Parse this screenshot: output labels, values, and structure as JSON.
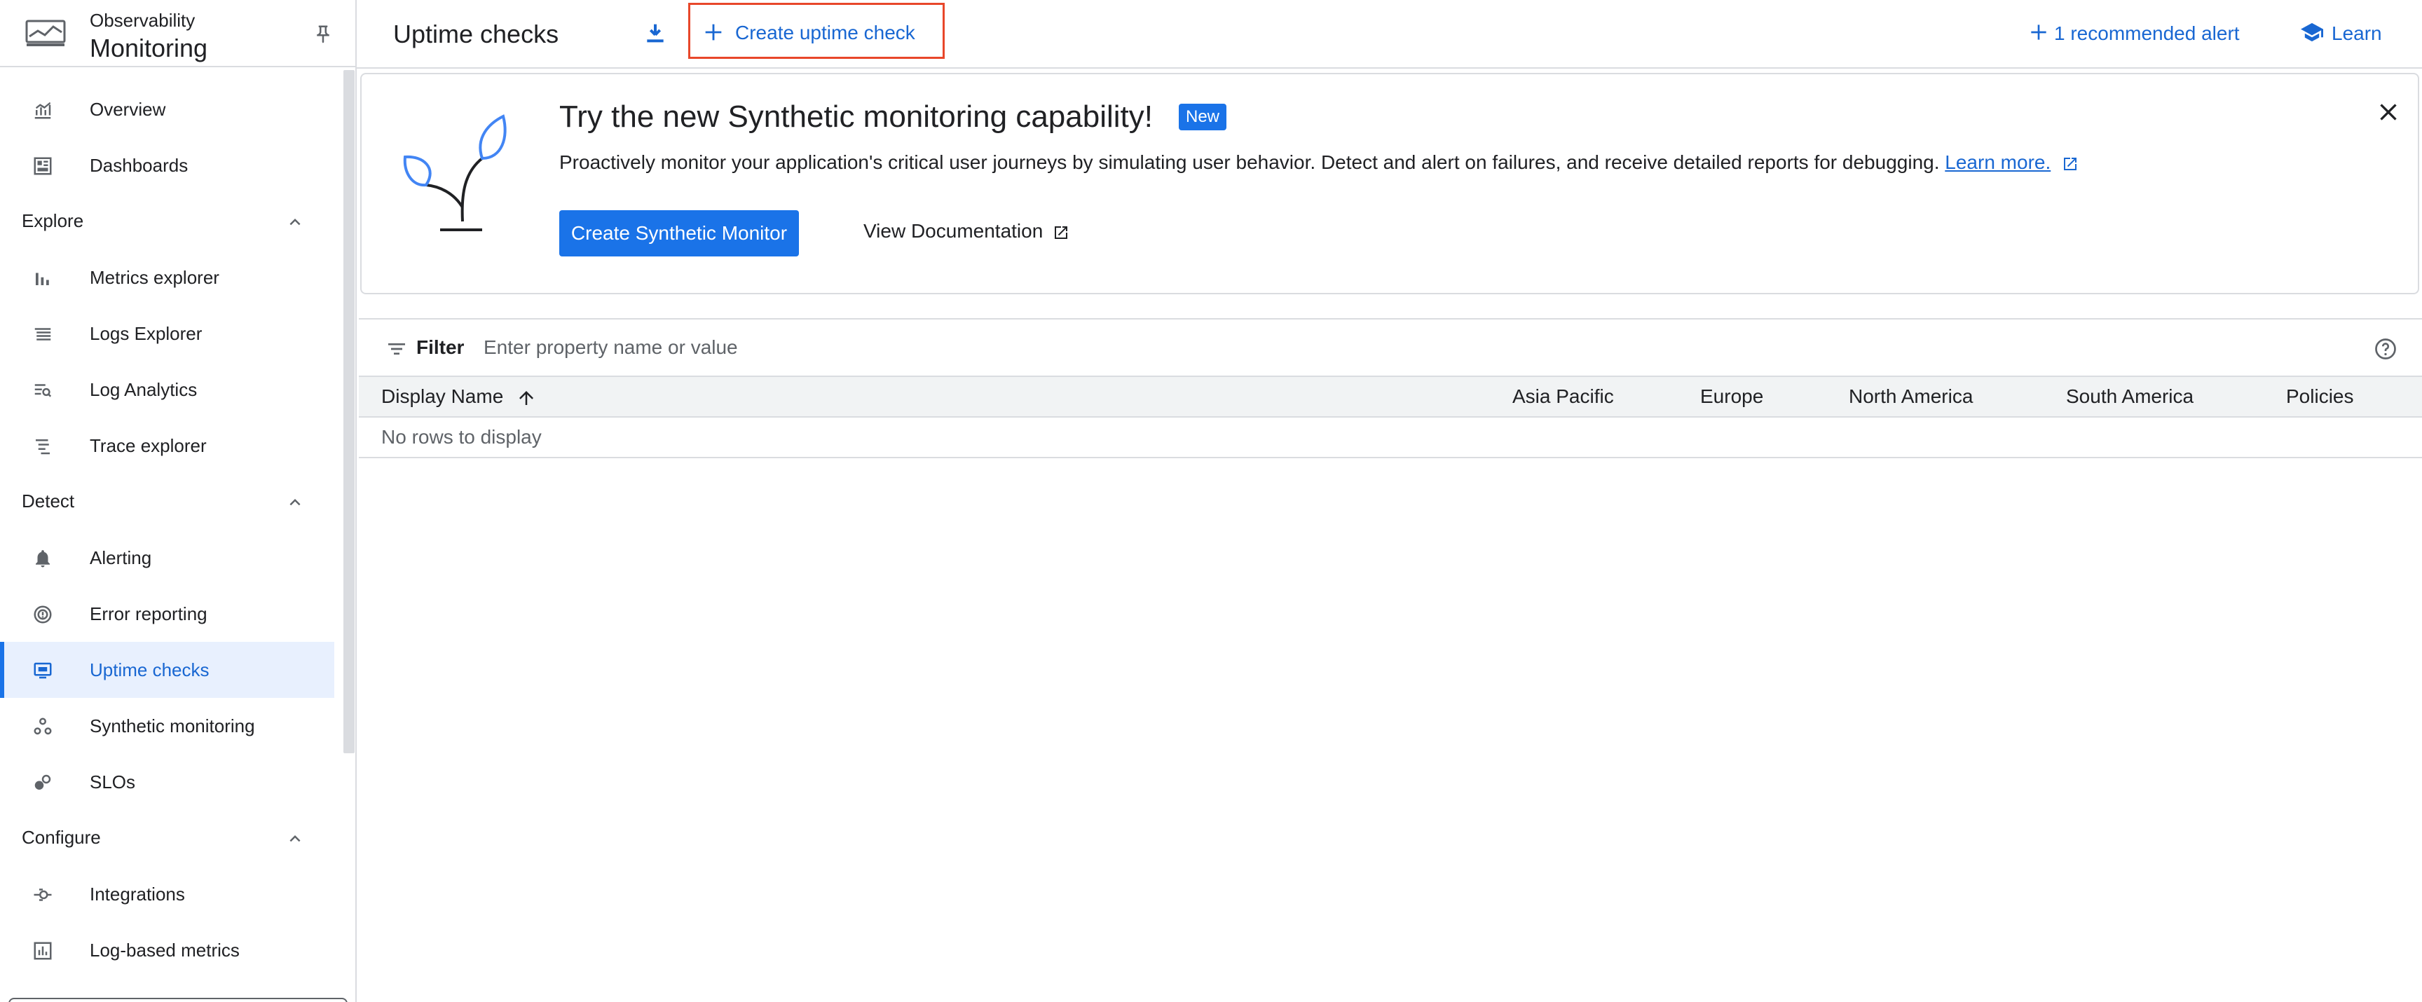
{
  "sidebar": {
    "product": "Observability",
    "title": "Monitoring",
    "items": [
      {
        "label": "Overview",
        "icon": "chart-line-icon"
      },
      {
        "label": "Dashboards",
        "icon": "dashboard-icon"
      }
    ],
    "sections": [
      {
        "label": "Explore",
        "expanded": true,
        "items": [
          {
            "label": "Metrics explorer",
            "icon": "bar-chart-icon"
          },
          {
            "label": "Logs Explorer",
            "icon": "logs-icon"
          },
          {
            "label": "Log Analytics",
            "icon": "log-search-icon"
          },
          {
            "label": "Trace explorer",
            "icon": "trace-icon"
          }
        ]
      },
      {
        "label": "Detect",
        "expanded": true,
        "items": [
          {
            "label": "Alerting",
            "icon": "bell-icon"
          },
          {
            "label": "Error reporting",
            "icon": "error-reporting-icon"
          },
          {
            "label": "Uptime checks",
            "icon": "monitor-icon",
            "active": true
          },
          {
            "label": "Synthetic monitoring",
            "icon": "synthetic-icon"
          },
          {
            "label": "SLOs",
            "icon": "slo-icon"
          }
        ]
      },
      {
        "label": "Configure",
        "expanded": true,
        "items": [
          {
            "label": "Integrations",
            "icon": "integrations-icon"
          },
          {
            "label": "Log-based metrics",
            "icon": "log-metrics-icon"
          }
        ]
      }
    ]
  },
  "header": {
    "title": "Uptime checks",
    "create_label": "Create uptime check",
    "recommended_alert_label": "1 recommended alert",
    "learn_label": "Learn"
  },
  "banner": {
    "title": "Try the new Synthetic monitoring capability!",
    "badge": "New",
    "description": "Proactively monitor your application's critical user journeys by simulating user behavior. Detect and alert on failures, and receive detailed reports for debugging.",
    "learn_more": "Learn more.",
    "primary_button": "Create Synthetic Monitor",
    "secondary_button": "View Documentation"
  },
  "filter": {
    "label": "Filter",
    "placeholder": "Enter property name or value"
  },
  "table": {
    "columns": [
      "Display Name",
      "Asia Pacific",
      "Europe",
      "North America",
      "South America",
      "Policies"
    ],
    "sort_column": "Display Name",
    "sort_direction": "ascending",
    "empty_message": "No rows to display"
  },
  "colors": {
    "accent": "#1a73e8",
    "link": "#1967d2",
    "highlight_border": "#e8472a",
    "active_bg": "#e8f0fe"
  }
}
